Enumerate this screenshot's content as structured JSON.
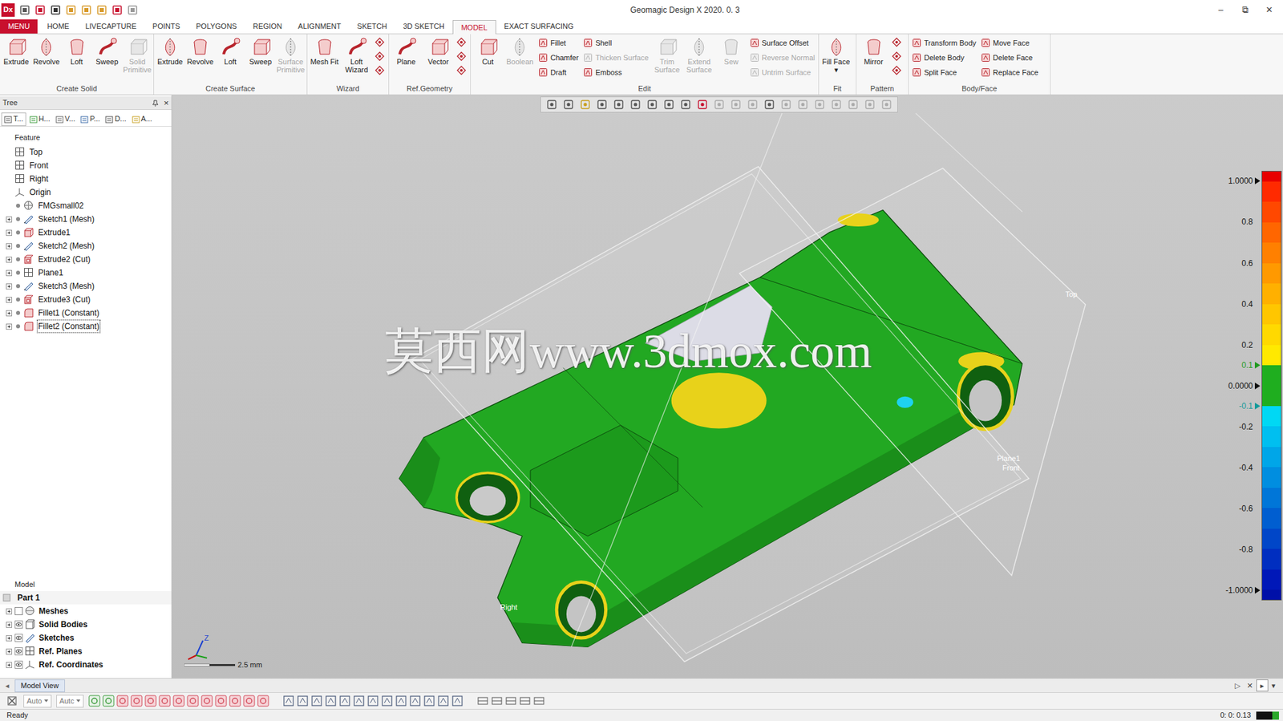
{
  "window": {
    "logo": "Dx",
    "title": "Geomagic Design X 2020. 0. 3",
    "controls": [
      "–",
      "⧉",
      "✕"
    ]
  },
  "ribbon_tabs": [
    {
      "label": "MENU",
      "selected": false,
      "kind": "menu"
    },
    {
      "label": "HOME",
      "selected": false,
      "kind": "tab"
    },
    {
      "label": "LIVECAPTURE",
      "selected": false,
      "kind": "tab"
    },
    {
      "label": "POINTS",
      "selected": false,
      "kind": "tab"
    },
    {
      "label": "POLYGONS",
      "selected": false,
      "kind": "tab"
    },
    {
      "label": "REGION",
      "selected": false,
      "kind": "tab"
    },
    {
      "label": "ALIGNMENT",
      "selected": false,
      "kind": "tab"
    },
    {
      "label": "SKETCH",
      "selected": false,
      "kind": "tab"
    },
    {
      "label": "3D SKETCH",
      "selected": false,
      "kind": "tab"
    },
    {
      "label": "MODEL",
      "selected": true,
      "kind": "tab"
    },
    {
      "label": "EXACT SURFACING",
      "selected": false,
      "kind": "tab"
    }
  ],
  "ribbon_groups": [
    {
      "label": "Create Solid",
      "items": [
        {
          "kind": "large",
          "label": "Extrude",
          "disabled": false
        },
        {
          "kind": "large",
          "label": "Revolve",
          "disabled": false
        },
        {
          "kind": "large",
          "label": "Loft",
          "disabled": false
        },
        {
          "kind": "large",
          "label": "Sweep",
          "disabled": false
        },
        {
          "kind": "large",
          "label": "Solid Primitive",
          "disabled": true
        }
      ]
    },
    {
      "label": "Create Surface",
      "items": [
        {
          "kind": "large",
          "label": "Extrude",
          "disabled": false
        },
        {
          "kind": "large",
          "label": "Revolve",
          "disabled": false
        },
        {
          "kind": "large",
          "label": "Loft",
          "disabled": false
        },
        {
          "kind": "large",
          "label": "Sweep",
          "disabled": false
        },
        {
          "kind": "large",
          "label": "Surface Primitive",
          "disabled": true
        }
      ]
    },
    {
      "label": "Wizard",
      "items": [
        {
          "kind": "large",
          "label": "Mesh Fit",
          "disabled": false
        },
        {
          "kind": "large",
          "label": "Loft Wizard",
          "disabled": false
        },
        {
          "kind": "icons",
          "entries": [
            {
              "disabled": false
            },
            {
              "disabled": false
            },
            {
              "disabled": false
            }
          ]
        }
      ]
    },
    {
      "label": "Ref.Geometry",
      "items": [
        {
          "kind": "large",
          "label": "Plane",
          "disabled": false
        },
        {
          "kind": "large",
          "label": "Vector",
          "disabled": false
        },
        {
          "kind": "icons",
          "entries": [
            {
              "disabled": false
            },
            {
              "disabled": false
            },
            {
              "disabled": false
            }
          ]
        }
      ]
    },
    {
      "label": "Edit",
      "items": [
        {
          "kind": "large",
          "label": "Cut",
          "disabled": false
        },
        {
          "kind": "large",
          "label": "Boolean",
          "disabled": true
        },
        {
          "kind": "column",
          "entries": [
            {
              "label": "Fillet",
              "disabled": false
            },
            {
              "label": "Chamfer",
              "disabled": false
            },
            {
              "label": "Draft",
              "disabled": false
            }
          ]
        },
        {
          "kind": "column",
          "entries": [
            {
              "label": "Shell",
              "disabled": false
            },
            {
              "label": "Thicken Surface",
              "disabled": true
            },
            {
              "label": "Emboss",
              "disabled": false
            }
          ]
        },
        {
          "kind": "large",
          "label": "Trim Surface",
          "disabled": true
        },
        {
          "kind": "large",
          "label": "Extend Surface",
          "disabled": true
        },
        {
          "kind": "large",
          "label": "Sew",
          "disabled": true
        },
        {
          "kind": "column",
          "entries": [
            {
              "label": "Surface Offset",
              "disabled": false
            },
            {
              "label": "Reverse Normal",
              "disabled": true
            },
            {
              "label": "Untrim Surface",
              "disabled": true
            }
          ]
        }
      ]
    },
    {
      "label": "Fit",
      "items": [
        {
          "kind": "large",
          "label": "Fill Face ▾",
          "disabled": false
        }
      ]
    },
    {
      "label": "Pattern",
      "items": [
        {
          "kind": "large",
          "label": "Mirror",
          "disabled": false
        },
        {
          "kind": "icons",
          "entries": [
            {
              "disabled": false
            },
            {
              "disabled": false
            },
            {
              "disabled": false
            }
          ]
        }
      ]
    },
    {
      "label": "Body/Face",
      "items": [
        {
          "kind": "column",
          "entries": [
            {
              "label": "Transform Body",
              "disabled": false
            },
            {
              "label": "Delete Body",
              "disabled": false
            },
            {
              "label": "Split Face",
              "disabled": false
            }
          ]
        },
        {
          "kind": "column",
          "entries": [
            {
              "label": "Move Face",
              "disabled": false
            },
            {
              "label": "Delete Face",
              "disabled": false
            },
            {
              "label": "Replace Face",
              "disabled": false
            }
          ]
        }
      ]
    }
  ],
  "tree_panel": {
    "title": "Tree",
    "close": "×",
    "tabs": [
      {
        "label": "T...",
        "selected": true
      },
      {
        "label": "H...",
        "selected": false
      },
      {
        "label": "V...",
        "selected": false
      },
      {
        "label": "P...",
        "selected": false
      },
      {
        "label": "D...",
        "selected": false
      },
      {
        "label": "A...",
        "selected": false
      }
    ],
    "feature_heading": "Feature",
    "features": [
      {
        "label": "Top",
        "kind": "plane",
        "expandable": false,
        "visibility_dot": false,
        "selected": false
      },
      {
        "label": "Front",
        "kind": "plane",
        "expandable": false,
        "visibility_dot": false,
        "selected": false
      },
      {
        "label": "Right",
        "kind": "plane",
        "expandable": false,
        "visibility_dot": false,
        "selected": false
      },
      {
        "label": "Origin",
        "kind": "origin",
        "expandable": false,
        "visibility_dot": false,
        "selected": false
      },
      {
        "label": "FMGsmall02",
        "kind": "mesh",
        "expandable": false,
        "visibility_dot": true,
        "selected": false
      },
      {
        "label": "Sketch1 (Mesh)",
        "kind": "sketch",
        "expandable": true,
        "visibility_dot": true,
        "selected": false
      },
      {
        "label": "Extrude1",
        "kind": "extrude",
        "expandable": true,
        "visibility_dot": true,
        "selected": false
      },
      {
        "label": "Sketch2 (Mesh)",
        "kind": "sketch",
        "expandable": true,
        "visibility_dot": true,
        "selected": false
      },
      {
        "label": "Extrude2 (Cut)",
        "kind": "cut",
        "expandable": true,
        "visibility_dot": true,
        "selected": false
      },
      {
        "label": "Plane1",
        "kind": "plane",
        "expandable": true,
        "visibility_dot": true,
        "selected": false
      },
      {
        "label": "Sketch3 (Mesh)",
        "kind": "sketch",
        "expandable": true,
        "visibility_dot": true,
        "selected": false
      },
      {
        "label": "Extrude3 (Cut)",
        "kind": "cut",
        "expandable": true,
        "visibility_dot": true,
        "selected": false
      },
      {
        "label": "Fillet1 (Constant)",
        "kind": "fillet",
        "expandable": true,
        "visibility_dot": true,
        "selected": false
      },
      {
        "label": "Fillet2 (Constant)",
        "kind": "fillet",
        "expandable": true,
        "visibility_dot": true,
        "selected": true
      }
    ],
    "model_heading": "Model",
    "part": {
      "label": "Part 1"
    },
    "model_items": [
      {
        "label": "Meshes",
        "expandable": true,
        "visible": false
      },
      {
        "label": "Solid Bodies",
        "expandable": true,
        "visible": true
      },
      {
        "label": "Sketches",
        "expandable": true,
        "visible": true
      },
      {
        "label": "Ref. Planes",
        "expandable": true,
        "visible": true
      },
      {
        "label": "Ref. Coordinates",
        "expandable": true,
        "visible": true
      }
    ]
  },
  "viewport": {
    "labels": [
      {
        "text": "Top"
      },
      {
        "text": "Plane1"
      },
      {
        "text": "Front"
      },
      {
        "text": "Right"
      }
    ],
    "watermark": "莫西网www.3dmox.com",
    "axis": "Z",
    "scale": "2.5 mm",
    "legend": {
      "over_color": "#e80000",
      "under_color": "#0010a8",
      "bands": [
        "#ff2a00",
        "#ff4800",
        "#ff6600",
        "#ff8000",
        "#ff9900",
        "#ffb000",
        "#ffc600",
        "#ffd900",
        "#ffe900",
        "#1fae1f",
        "#1fae1f",
        "#00d8f4",
        "#00bff0",
        "#00a6e8",
        "#008ee0",
        "#0076d8",
        "#005ed0",
        "#0046c8",
        "#002ec0",
        "#0018b8"
      ],
      "ticks": [
        {
          "label": "1.0000",
          "arrow": true,
          "color": "#111111"
        },
        {
          "label": "0.8",
          "arrow": false,
          "color": "#111111"
        },
        {
          "label": "0.6",
          "arrow": false,
          "color": "#111111"
        },
        {
          "label": "0.4",
          "arrow": false,
          "color": "#111111"
        },
        {
          "label": "0.2",
          "arrow": false,
          "color": "#111111"
        },
        {
          "label": "0.1",
          "arrow": true,
          "color": "#1f9a1f"
        },
        {
          "label": "0.0000",
          "arrow": true,
          "color": "#111111"
        },
        {
          "label": "-0.1",
          "arrow": true,
          "color": "#149a9a"
        },
        {
          "label": "-0.2",
          "arrow": false,
          "color": "#111111"
        },
        {
          "label": "-0.4",
          "arrow": false,
          "color": "#111111"
        },
        {
          "label": "-0.6",
          "arrow": false,
          "color": "#111111"
        },
        {
          "label": "-0.8",
          "arrow": false,
          "color": "#111111"
        },
        {
          "label": "-1.0000",
          "arrow": true,
          "color": "#111111"
        }
      ]
    }
  },
  "view_tabs": {
    "left": "◂",
    "tab": "Model View",
    "right": [
      "▷",
      "✕",
      "▸",
      "▾"
    ]
  },
  "bottom_toolbar": {
    "dropdowns": [
      {
        "label": "Auto"
      },
      {
        "label": "Autc"
      }
    ]
  },
  "status_bar": {
    "text": "Ready",
    "coords": "0: 0: 0.13"
  }
}
